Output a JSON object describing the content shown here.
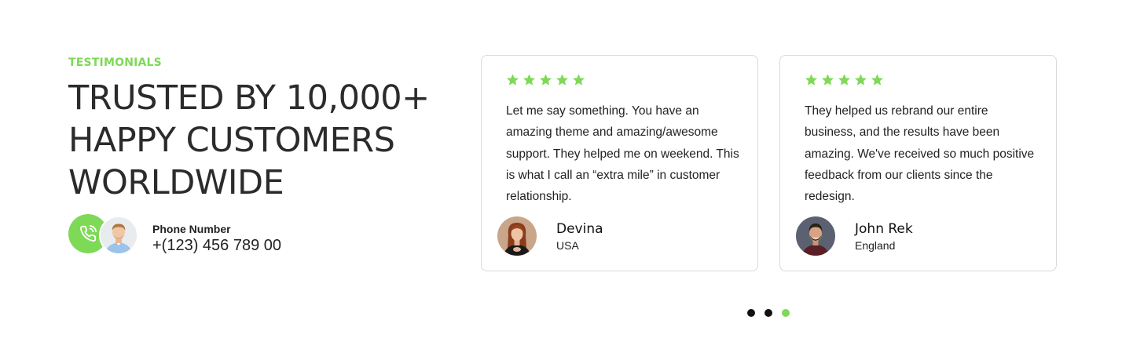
{
  "section": {
    "eyebrow": "TESTIMONIALS",
    "headline_lines": [
      "TRUSTED BY 10,000+",
      "HAPPY CUSTOMERS",
      "WORLDWIDE"
    ]
  },
  "contact": {
    "icon": "phone-call-icon",
    "label": "Phone Number",
    "number": "+(123) 456 789 00"
  },
  "testimonials": [
    {
      "rating": 5,
      "quote": "Let me say something. You have an amazing theme and amazing/awesome support. They helped me on weekend. This is what I call an “extra mile” in customer relationship.",
      "name": "Devina",
      "location": "USA"
    },
    {
      "rating": 5,
      "quote": "They helped us rebrand our entire business, and the results have been amazing. We've received so much positive feedback from our clients since the redesign.",
      "name": "John Rek",
      "location": "England"
    }
  ],
  "pagination": {
    "count": 3,
    "active_index": 2
  },
  "colors": {
    "accent": "#7ed957",
    "text": "#222222",
    "border": "#d9d9d9"
  }
}
